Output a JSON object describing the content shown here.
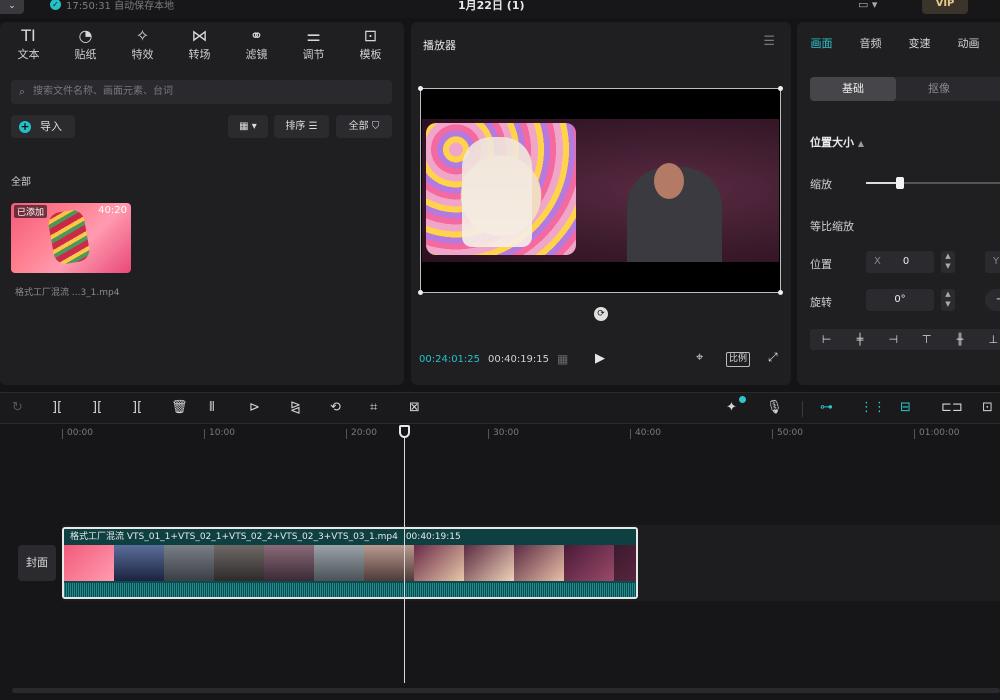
{
  "topbar": {
    "menu_icon": "chevron-down-icon",
    "autosave_text": "17:50:31 自动保存本地",
    "project_title": "1月22日 (1)",
    "vip_label": "VIP"
  },
  "media_tabs": [
    {
      "label": "文本",
      "icon": "text-icon",
      "glyph": "TI"
    },
    {
      "label": "贴纸",
      "icon": "sticker-icon",
      "glyph": "◔"
    },
    {
      "label": "特效",
      "icon": "effects-icon",
      "glyph": "✧"
    },
    {
      "label": "转场",
      "icon": "transition-icon",
      "glyph": "⋈"
    },
    {
      "label": "滤镜",
      "icon": "filter-icon",
      "glyph": "⚭"
    },
    {
      "label": "调节",
      "icon": "adjust-icon",
      "glyph": "⚌"
    },
    {
      "label": "模板",
      "icon": "template-icon",
      "glyph": "⊡"
    }
  ],
  "media": {
    "search_placeholder": "搜索文件名称、画面元素、台词",
    "import_label": "导入",
    "sort_label": "排序",
    "all_label": "全部",
    "section_label": "全部",
    "clip": {
      "added_badge": "已添加",
      "duration": "40:20",
      "name": "格式工厂混流 ...3_1.mp4"
    }
  },
  "player": {
    "title": "播放器",
    "current_time": "00:24:01:25",
    "total_time": "00:40:19:15",
    "ratio_label": "比例"
  },
  "props": {
    "tabs": [
      {
        "label": "画面",
        "active": true
      },
      {
        "label": "音频",
        "active": false
      },
      {
        "label": "变速",
        "active": false
      },
      {
        "label": "动画",
        "active": false
      }
    ],
    "seg_basic": "基础",
    "seg_cutout": "抠像",
    "section_title": "位置大小",
    "scale_label": "缩放",
    "uniform_scale_label": "等比缩放",
    "position_label": "位置",
    "pos_x_prefix": "X",
    "pos_x_value": "0",
    "pos_y_prefix": "Y",
    "rotate_label": "旋转",
    "rotate_value": "0°"
  },
  "timeline": {
    "ruler": [
      "00:00",
      "10:00",
      "20:00",
      "30:00",
      "40:00",
      "50:00",
      "01:00:00"
    ],
    "cover_label": "封面",
    "clip_title": "格式工厂混流 VTS_01_1+VTS_02_1+VTS_02_2+VTS_02_3+VTS_03_1.mp4",
    "clip_duration": "00:40:19:15"
  }
}
